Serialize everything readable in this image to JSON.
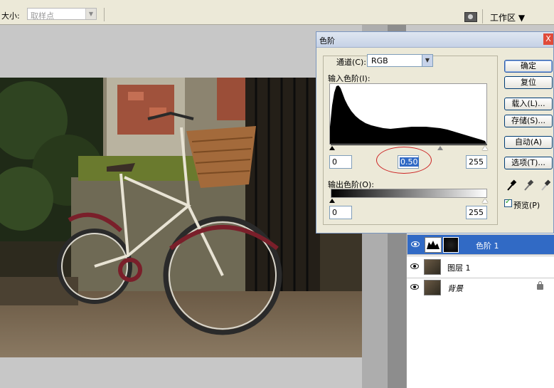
{
  "options_bar": {
    "size_label": "大小:",
    "sample_value": "取样点",
    "workspace_label": "工作区 ▼"
  },
  "dialog": {
    "title": "色阶",
    "close_glyph": "X",
    "channel_label": "通道(C):",
    "channel_value": "RGB",
    "input_levels_label": "输入色阶(I):",
    "input_black": "0",
    "input_gamma": "0.50",
    "input_white": "255",
    "output_levels_label": "输出色阶(O):",
    "output_black": "0",
    "output_white": "255",
    "buttons": {
      "ok": "确定",
      "reset": "复位",
      "load": "载入(L)...",
      "save": "存储(S)...",
      "auto": "自动(A)",
      "options": "选项(T)..."
    },
    "preview_label": "预览(P)",
    "preview_checked": true
  },
  "layers": [
    {
      "name": "色阶 1",
      "selected": true
    },
    {
      "name": "图层 1",
      "selected": false
    },
    {
      "name": "背景",
      "selected": false,
      "locked": true
    }
  ],
  "colors": {
    "selection": "#316ac5",
    "dialog_bg": "#ece9d8"
  }
}
